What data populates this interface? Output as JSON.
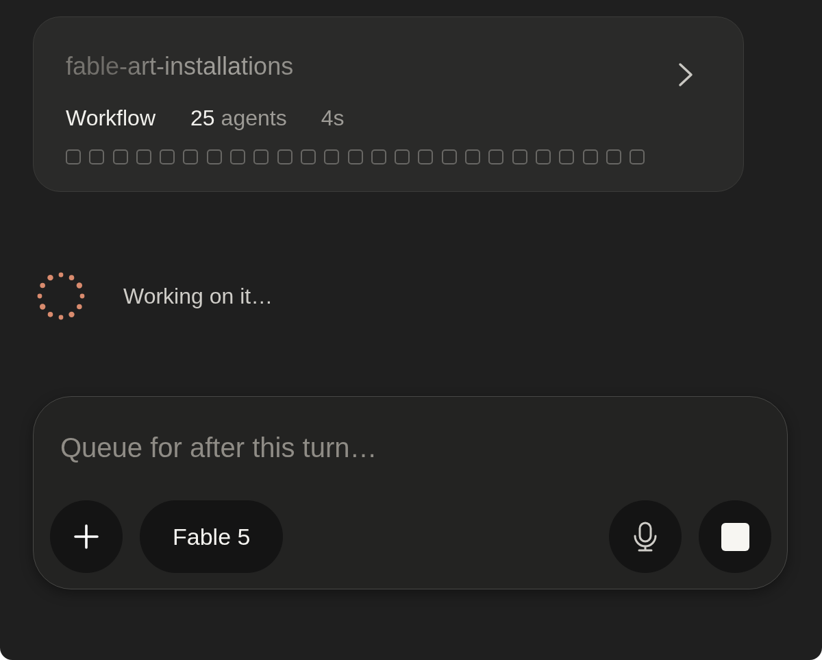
{
  "workflow_card": {
    "title": "fable-art-installations",
    "type_label": "Workflow",
    "agent_count": "25",
    "agent_unit": "agents",
    "elapsed": "4s",
    "agents": [
      {
        "done": false
      },
      {
        "done": false
      },
      {
        "done": false
      },
      {
        "done": false
      },
      {
        "done": false
      },
      {
        "done": false
      },
      {
        "done": false
      },
      {
        "done": false
      },
      {
        "done": false
      },
      {
        "done": false
      },
      {
        "done": false
      },
      {
        "done": false
      },
      {
        "done": false
      },
      {
        "done": false
      },
      {
        "done": false
      },
      {
        "done": false
      },
      {
        "done": false
      },
      {
        "done": false
      },
      {
        "done": false
      },
      {
        "done": false
      },
      {
        "done": false
      },
      {
        "done": false
      },
      {
        "done": false
      },
      {
        "done": false
      },
      {
        "done": false
      }
    ]
  },
  "status": {
    "text": "Working on it…"
  },
  "composer": {
    "placeholder": "Queue for after this turn…",
    "model": "Fable 5"
  }
}
